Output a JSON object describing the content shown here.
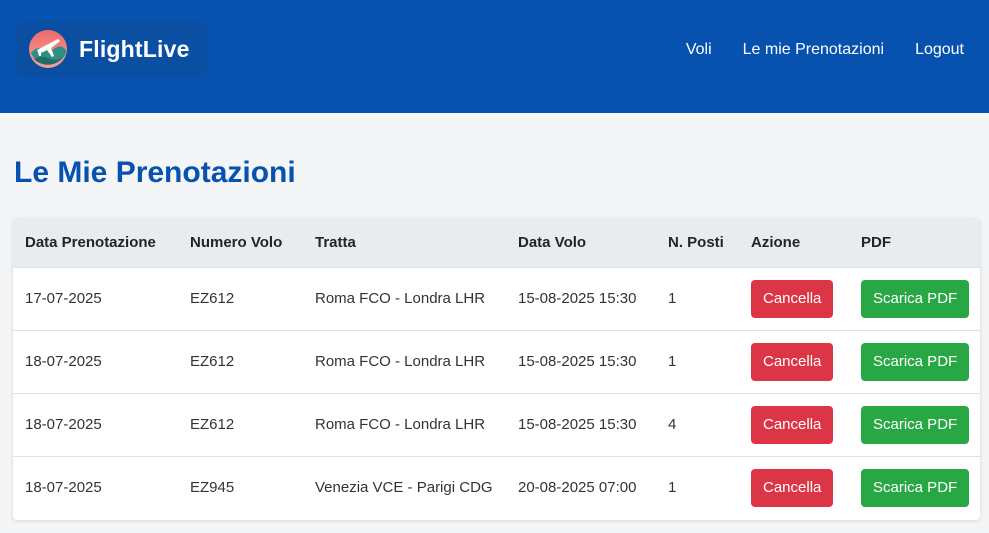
{
  "brand": {
    "name": "FlightLive"
  },
  "nav": [
    {
      "label": "Voli"
    },
    {
      "label": "Le mie Prenotazioni"
    },
    {
      "label": "Logout"
    }
  ],
  "page": {
    "title": "Le Mie Prenotazioni"
  },
  "table": {
    "headers": [
      "Data Prenotazione",
      "Numero Volo",
      "Tratta",
      "Data Volo",
      "N. Posti",
      "Azione",
      "PDF"
    ],
    "rows": [
      {
        "data_prenotazione": "17-07-2025",
        "numero_volo": "EZ612",
        "tratta": "Roma FCO - Londra LHR",
        "data_volo": "15-08-2025 15:30",
        "posti": "1",
        "azione": "Cancella",
        "pdf": "Scarica PDF"
      },
      {
        "data_prenotazione": "18-07-2025",
        "numero_volo": "EZ612",
        "tratta": "Roma FCO - Londra LHR",
        "data_volo": "15-08-2025 15:30",
        "posti": "1",
        "azione": "Cancella",
        "pdf": "Scarica PDF"
      },
      {
        "data_prenotazione": "18-07-2025",
        "numero_volo": "EZ612",
        "tratta": "Roma FCO - Londra LHR",
        "data_volo": "15-08-2025 15:30",
        "posti": "4",
        "azione": "Cancella",
        "pdf": "Scarica PDF"
      },
      {
        "data_prenotazione": "18-07-2025",
        "numero_volo": "EZ945",
        "tratta": "Venezia VCE - Parigi CDG",
        "data_volo": "20-08-2025 07:00",
        "posti": "1",
        "azione": "Cancella",
        "pdf": "Scarica PDF"
      }
    ]
  },
  "colors": {
    "header_bg": "#0752ae",
    "title": "#0752ae",
    "cancel_button": "#dc3545",
    "pdf_button": "#28a745"
  },
  "icons": {
    "logo": "globe-airplane-icon"
  }
}
